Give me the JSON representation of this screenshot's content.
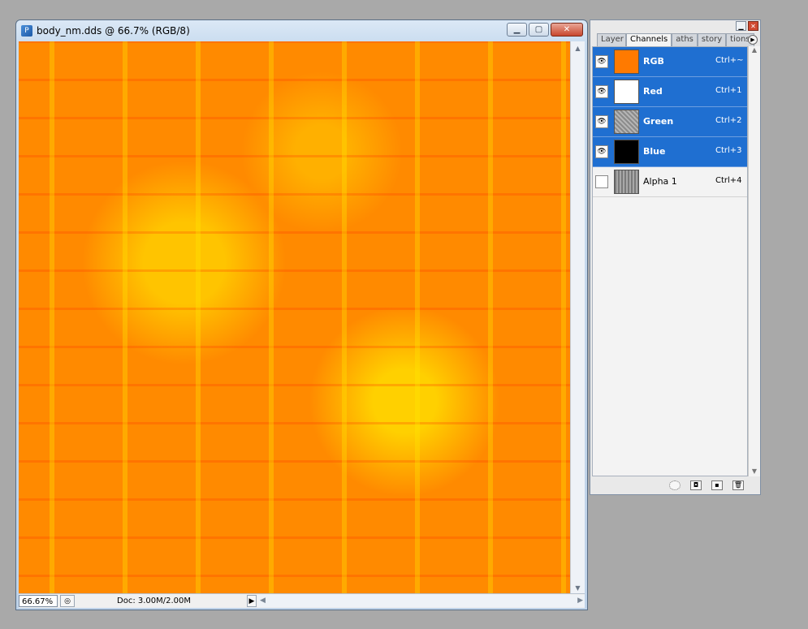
{
  "document": {
    "title": "body_nm.dds @ 66.7% (RGB/8)",
    "zoom": "66.67%",
    "doc_info": "Doc: 3.00M/2.00M",
    "colors": {
      "texture_base": "#ff8a00",
      "texture_highlight": "#ffd000"
    }
  },
  "panel": {
    "tabs": [
      {
        "label": "Layer"
      },
      {
        "label": "Channels"
      },
      {
        "label": "aths"
      },
      {
        "label": "story"
      },
      {
        "label": "tions"
      }
    ],
    "channels": [
      {
        "name": "RGB",
        "shortcut": "Ctrl+~",
        "visible": true,
        "selected": true,
        "thumb": "#ff7a00"
      },
      {
        "name": "Red",
        "shortcut": "Ctrl+1",
        "visible": true,
        "selected": true,
        "thumb": "#ffffff"
      },
      {
        "name": "Green",
        "shortcut": "Ctrl+2",
        "visible": true,
        "selected": true,
        "thumb": "#9a9a9a"
      },
      {
        "name": "Blue",
        "shortcut": "Ctrl+3",
        "visible": true,
        "selected": true,
        "thumb": "#000000"
      },
      {
        "name": "Alpha 1",
        "shortcut": "Ctrl+4",
        "visible": false,
        "selected": false,
        "thumb": "#8f8f8f"
      }
    ],
    "selection_color": "#1f6fd1"
  }
}
